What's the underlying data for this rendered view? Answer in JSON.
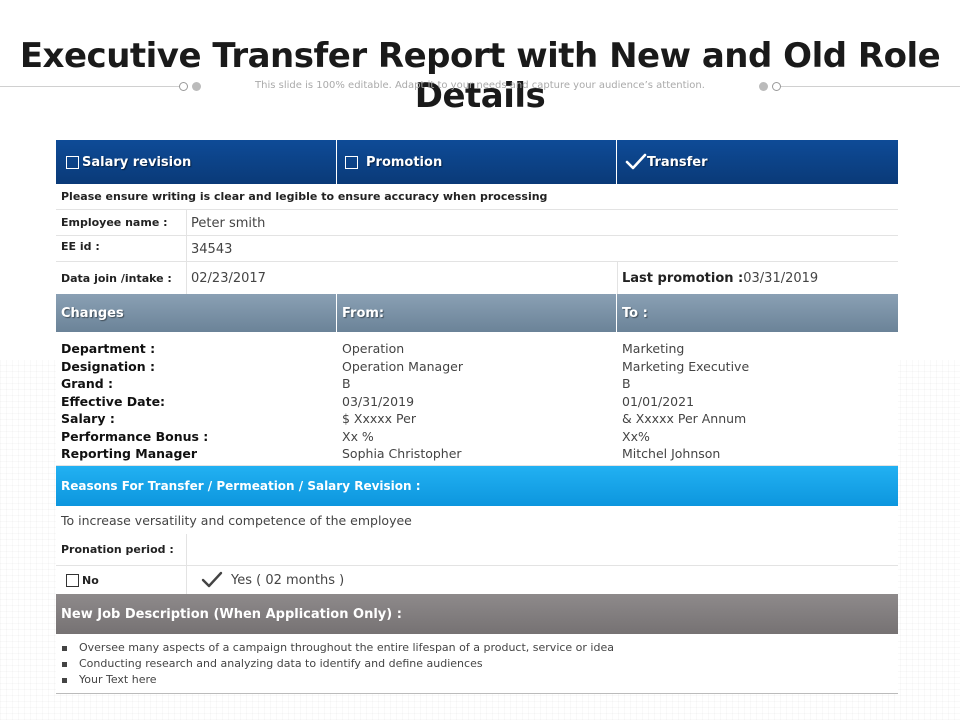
{
  "page": {
    "title": "Executive Transfer Report with New and Old Role Details",
    "subtitle": "This slide is 100% editable. Adapt it to your needs and capture your audience’s attention."
  },
  "form": {
    "types": [
      {
        "label": "Salary revision",
        "checked": false
      },
      {
        "label": "Promotion",
        "checked": false
      },
      {
        "label": "Transfer",
        "checked": true
      }
    ],
    "instruction": "Please ensure writing is clear and legible to ensure accuracy when processing",
    "employee_name_label": "Employee name :",
    "employee_name": "Peter smith",
    "ee_id_label": "EE id :",
    "ee_id": "34543",
    "date_join_label": "Data join /intake :",
    "date_join": "02/23/2017",
    "last_promotion_label": "Last promotion :",
    "last_promotion": "03/31/2019"
  },
  "changes": {
    "headers": [
      "Changes",
      "From:",
      "To :"
    ],
    "labels": [
      "Department :",
      "Designation :",
      "Grand :",
      "Effective Date:",
      "Salary :",
      "Performance Bonus :",
      "Reporting Manager"
    ],
    "from": [
      "Operation",
      "Operation Manager",
      "B",
      "03/31/2019",
      "$ Xxxxx Per",
      "Xx %",
      "Sophia Christopher"
    ],
    "to": [
      "Marketing",
      "Marketing Executive",
      "B",
      "01/01/2021",
      "& Xxxxx Per Annum",
      "Xx%",
      "Mitchel Johnson"
    ]
  },
  "reasons": {
    "header": "Reasons For Transfer / Permeation / Salary Revision :",
    "text": "To increase versatility and competence of the employee",
    "probation_label": "Pronation period :",
    "option_no": "No",
    "option_yes": "Yes ( 02 months )",
    "yes_checked": true
  },
  "job": {
    "header": "New Job Description (When Application Only) :",
    "bullets": [
      "Oversee many aspects of a campaign throughout the entire lifespan of a product, service or idea",
      "Conducting research and analyzing data to identify and define audiences",
      "Your Text here"
    ]
  },
  "colors": {
    "header_blue": "#0e4b97",
    "changes_slate": "#7a90a5",
    "reason_cyan": "#1aa6ec",
    "job_gray": "#817d7e"
  },
  "icons": [
    "checkbox-icon",
    "checkmark-icon",
    "bullet-icon"
  ]
}
